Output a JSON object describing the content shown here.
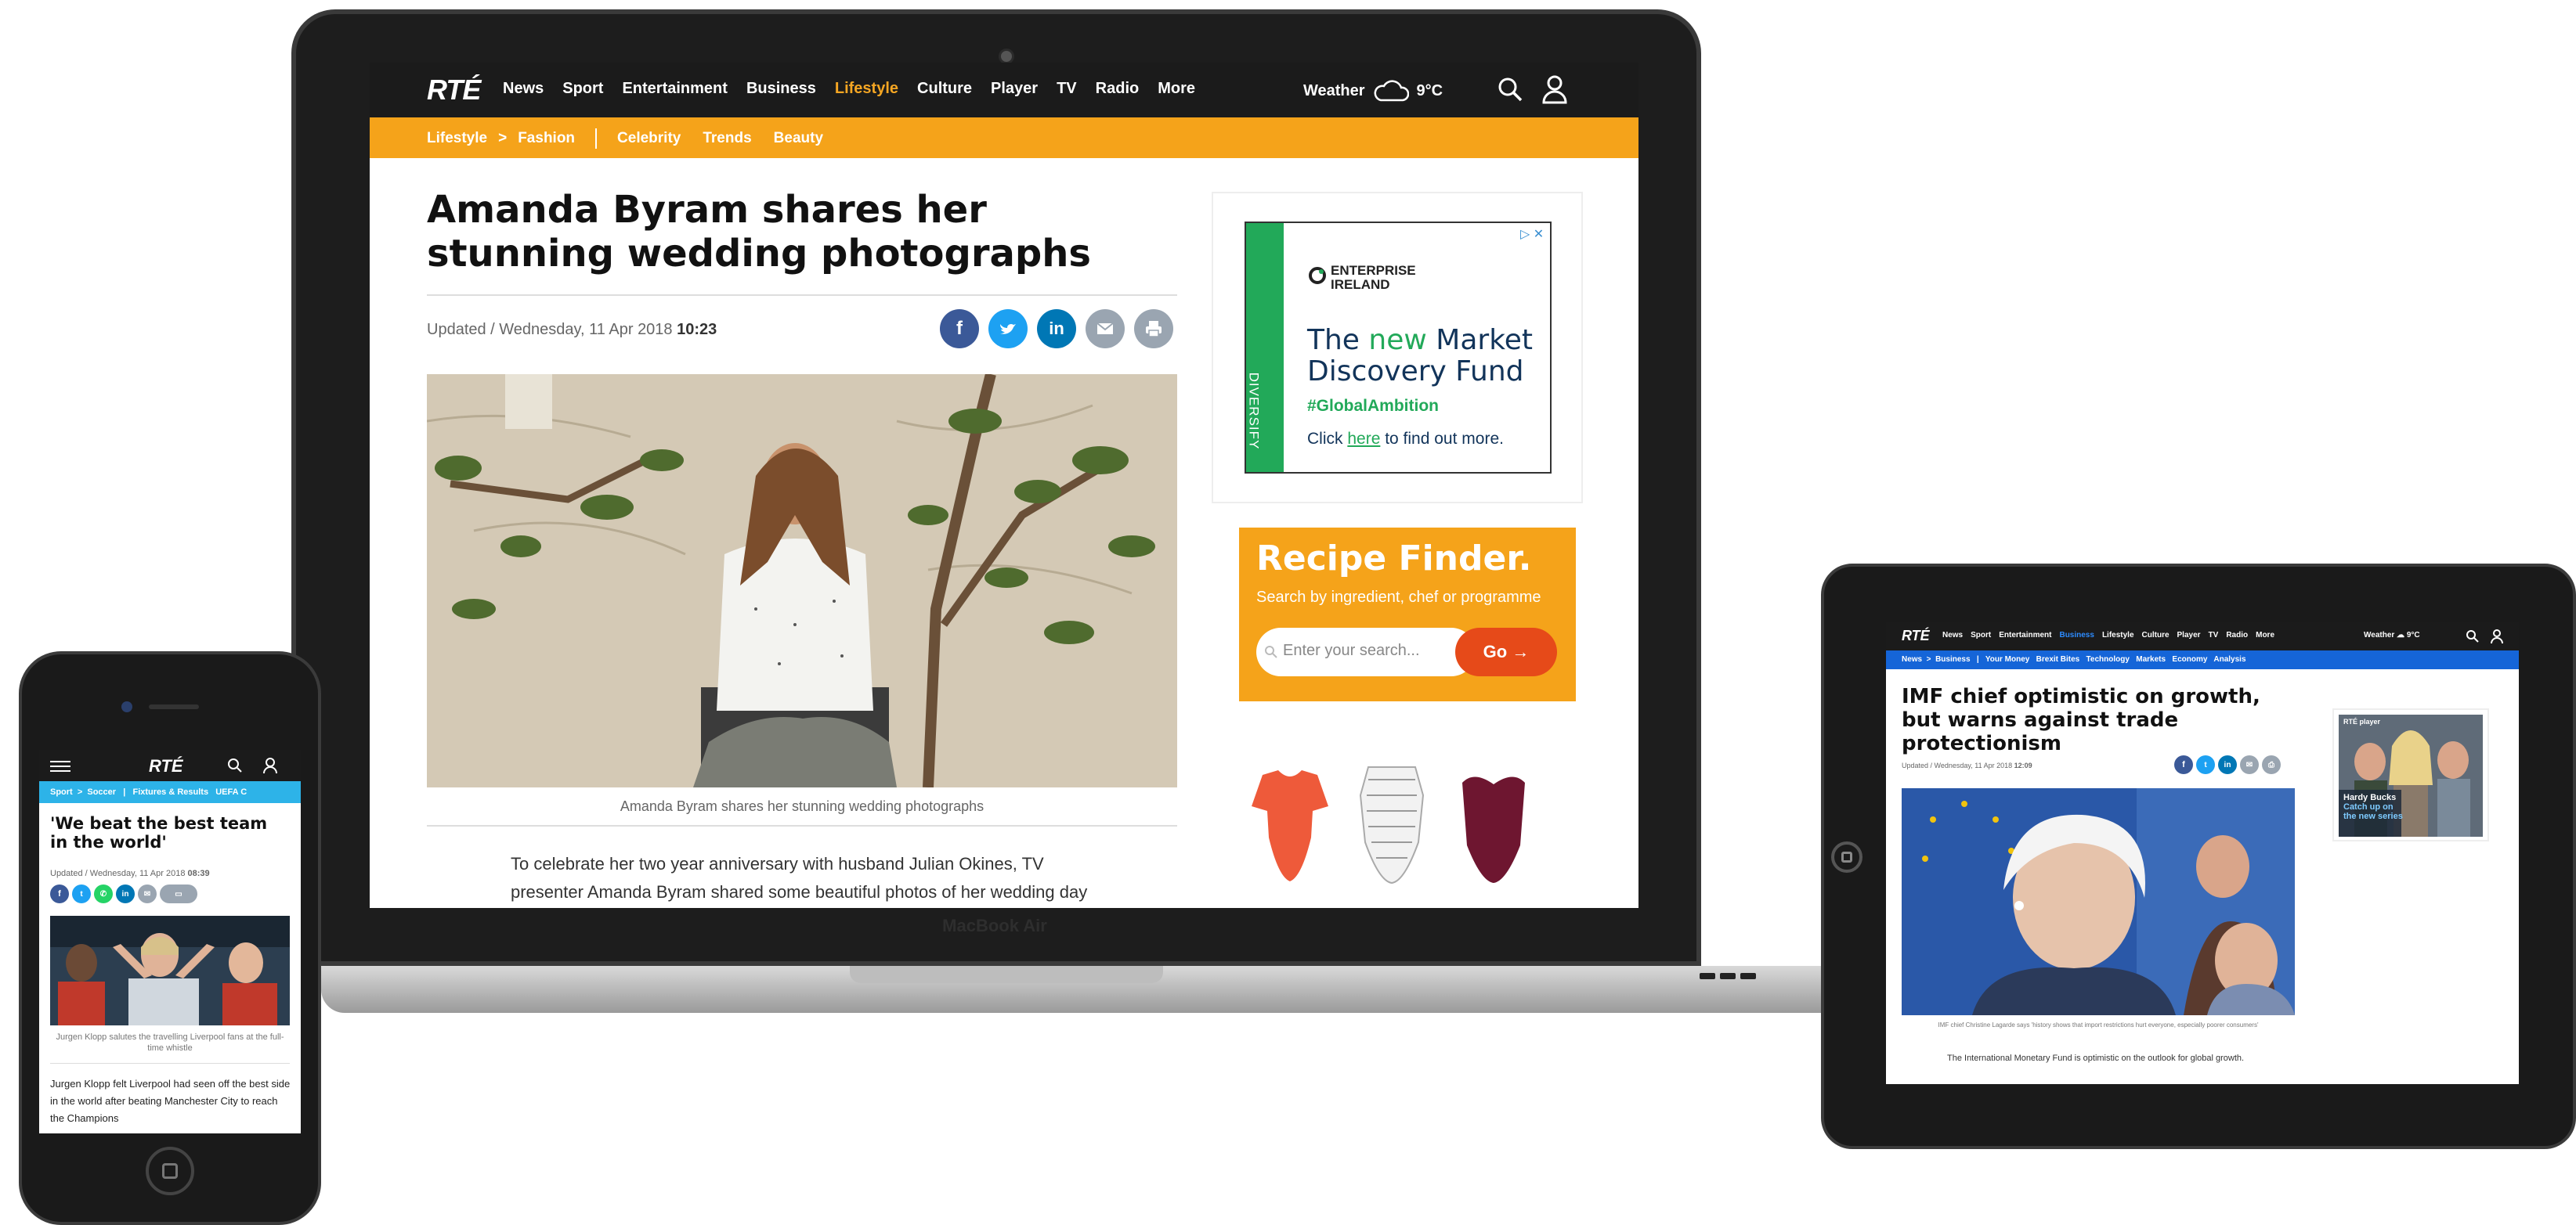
{
  "laptop": {
    "bezel_label": "MacBook Air",
    "nav": {
      "logo": "RTÉ",
      "items": [
        "News",
        "Sport",
        "Entertainment",
        "Business",
        "Lifestyle",
        "Culture",
        "Player",
        "TV",
        "Radio",
        "More"
      ],
      "active": "Lifestyle",
      "weather_label": "Weather",
      "temperature": "9°C"
    },
    "subnav": {
      "breadcrumb_parent": "Lifestyle",
      "breadcrumb_sep": ">",
      "breadcrumb_current": "Fashion",
      "items": [
        "Celebrity",
        "Trends",
        "Beauty"
      ]
    },
    "article": {
      "title": "Amanda Byram shares her stunning wedding photographs",
      "updated_prefix": "Updated / Wednesday, 11 Apr 2018",
      "updated_time": "10:23",
      "caption": "Amanda Byram shares her stunning wedding photographs",
      "body": "To celebrate her two year anniversary with husband Julian Okines, TV presenter Amanda Byram shared some beautiful photos of her wedding day"
    },
    "ad": {
      "strip_text": "DIVERSIFY",
      "brand_line1": "ENTERPRISE",
      "brand_line2": "IRELAND",
      "headline_pre": "The ",
      "headline_new": "new",
      "headline_post": " Market Discovery Fund",
      "hashtag": "#GlobalAmbition",
      "click_pre": "Click ",
      "click_link": "here",
      "click_post": " to find out more.",
      "close": "▷ ✕"
    },
    "recipe": {
      "title": "Recipe Finder.",
      "subtitle": "Search by ingredient, chef or programme",
      "placeholder": "Enter your search...",
      "button": "Go →"
    }
  },
  "tablet": {
    "nav": {
      "logo": "RTÉ",
      "items": [
        "News",
        "Sport",
        "Entertainment",
        "Business",
        "Lifestyle",
        "Culture",
        "Player",
        "TV",
        "Radio",
        "More"
      ],
      "active": "Business",
      "weather": "Weather ☁ 9°C"
    },
    "subnav": {
      "text": "News  >  Business   |   Your Money   Brexit Bites   Technology   Markets   Economy   Analysis"
    },
    "article": {
      "title": "IMF chief optimistic on growth, but warns against trade protectionism",
      "updated_prefix": "Updated / Wednesday, 11 Apr 2018",
      "updated_time": "12:09",
      "caption": "IMF chief Christine Lagarde says 'history shows that import restrictions hurt everyone, especially poorer consumers'",
      "body": "The International Monetary Fund is optimistic on the outlook for global growth."
    },
    "ad": {
      "title": "Hardy Bucks",
      "line2": "Catch up on",
      "line3": "the new series",
      "badge": "RTÉ player"
    }
  },
  "phone": {
    "nav": {
      "logo": "RTÉ"
    },
    "subnav": {
      "text": "Sport  >  Soccer   |   Fixtures & Results   UEFA C"
    },
    "article": {
      "title": "'We beat the best team in the world'",
      "updated_prefix": "Updated / Wednesday, 11 Apr 2018",
      "updated_time": "08:39",
      "caption": "Jurgen Klopp salutes the travelling Liverpool fans at the full-time whistle",
      "body": "Jurgen Klopp felt Liverpool had seen off the best side in the world after beating Manchester City to reach the Champions"
    }
  },
  "colors": {
    "nav_bg": "#1b1b1b",
    "lifestyle_orange": "#f5a31a",
    "business_blue": "#1565d8",
    "sport_cyan": "#2db3e8",
    "facebook": "#3b5998",
    "twitter": "#1da1f2",
    "linkedin": "#0077b5",
    "email": "#9aa5b1",
    "print": "#9aa5b1",
    "whatsapp": "#25d366",
    "go_button": "#e64a19"
  }
}
